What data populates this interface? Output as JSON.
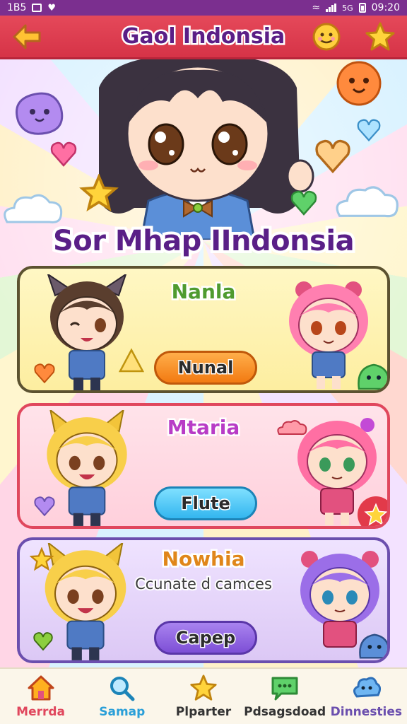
{
  "status_bar": {
    "time_left": "1B5",
    "network": "5G",
    "time": "09:20"
  },
  "header": {
    "title": "Gaol Indonsia"
  },
  "hero": {
    "subtitle": "Sor Mhap IIndonsia"
  },
  "cards": [
    {
      "name": "Nanla",
      "description": "",
      "button": "Nunal"
    },
    {
      "name": "Mtaria",
      "description": "",
      "button": "Flute"
    },
    {
      "name": "Nowhia",
      "description": "Ccunate d camces",
      "button": "Capep"
    }
  ],
  "nav": [
    {
      "label": "Merrda",
      "icon": "home-icon"
    },
    {
      "label": "Samap",
      "icon": "search-icon"
    },
    {
      "label": "Plparter",
      "icon": "star-icon"
    },
    {
      "label": "Pdsagsdoad",
      "icon": "chat-icon"
    },
    {
      "label": "Dinnesties",
      "icon": "cloud-icon"
    }
  ],
  "colors": {
    "header": "#d63347",
    "title": "#5b1e86",
    "accent_orange": "#f27a12",
    "accent_blue": "#33b6ef",
    "accent_purple": "#7d4fd6"
  }
}
